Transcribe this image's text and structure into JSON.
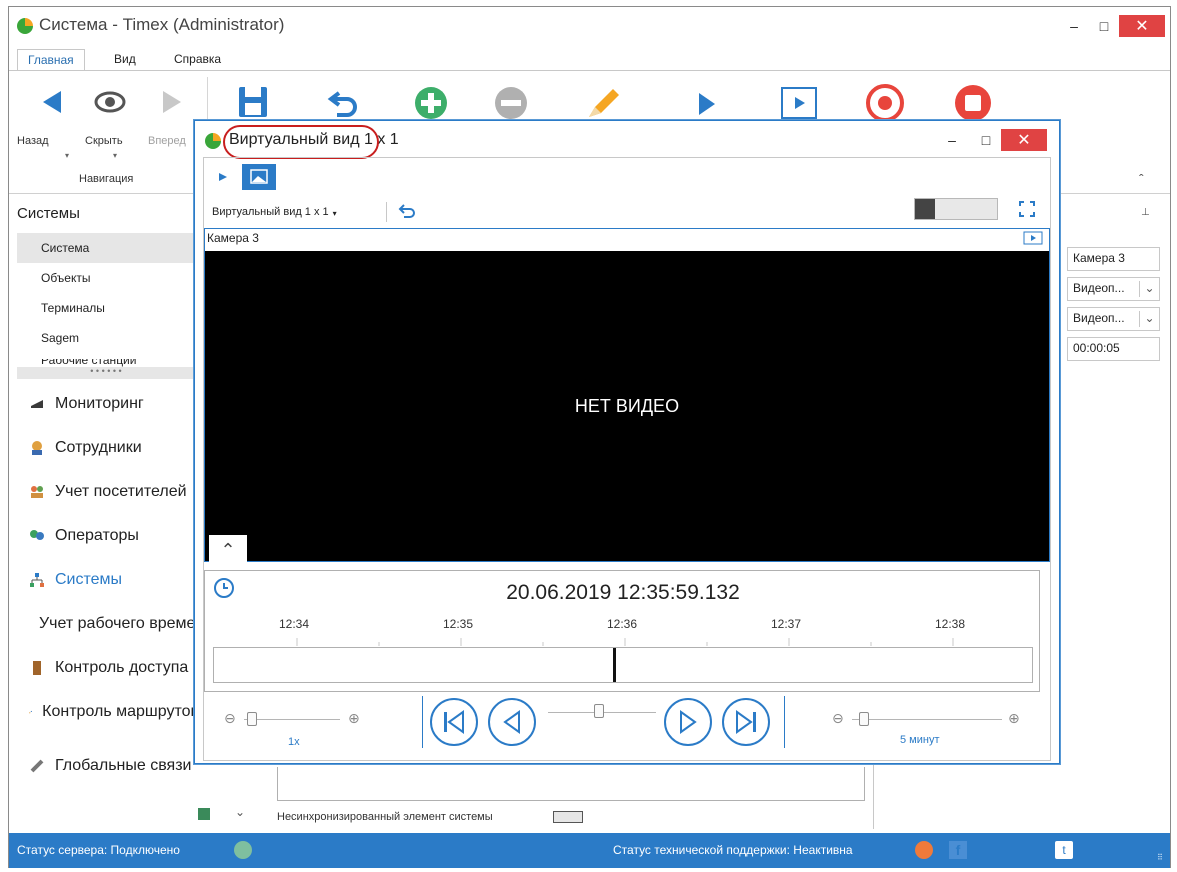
{
  "window": {
    "title": "Система - Timex (Administrator)",
    "minimize": "–",
    "maximize": "□",
    "close": "✕"
  },
  "menu": {
    "tabs": [
      "Главная",
      "Вид",
      "Справка"
    ]
  },
  "ribbon": {
    "nav_buttons": [
      "Назад",
      "Скрыть",
      "Вперед"
    ],
    "group_label": "Навигация"
  },
  "sidebar": {
    "section_title": "Системы",
    "tree_items": [
      "Система",
      "Объекты",
      "Терминалы",
      "Sagem",
      "Рабочие станции"
    ],
    "nav_items": [
      {
        "label": "Мониторинг",
        "icon": "monitor-icon"
      },
      {
        "label": "Сотрудники",
        "icon": "employees-icon"
      },
      {
        "label": "Учет посетителей",
        "icon": "visitors-icon"
      },
      {
        "label": "Операторы",
        "icon": "operators-icon"
      },
      {
        "label": "Системы",
        "icon": "systems-icon"
      },
      {
        "label": "Учет рабочего времени",
        "icon": "clock-icon"
      },
      {
        "label": "Контроль доступа",
        "icon": "door-icon"
      },
      {
        "label": "Контроль маршрутов",
        "icon": "route-icon"
      },
      {
        "label": "Глобальные связи",
        "icon": "link-icon"
      }
    ]
  },
  "right_panel": {
    "camera": "Камера 3",
    "select1": "Видеоп...",
    "select2": "Видеоп...",
    "time": "00:00:05"
  },
  "legend": {
    "unsync_label": "Несинхронизированный элемент системы"
  },
  "status": {
    "server": "Статус сервера: Подключено",
    "support": "Статус технической поддержки: Неактивна",
    "server_color": "#7fbf9f",
    "support_color": "#f07a3a"
  },
  "vwin": {
    "title": "Виртуальный вид 1 x 1",
    "view_dropdown": "Виртуальный вид 1 x 1",
    "camera_label": "Камера 3",
    "no_video": "НЕТ ВИДЕО",
    "timestamp": "20.06.2019 12:35:59.132",
    "ticks": [
      "12:34",
      "12:35",
      "12:36",
      "12:37",
      "12:38"
    ],
    "speed_label": "1x",
    "range_label": "5 минут",
    "cursor_fraction": 0.49,
    "speed_fraction": 0.08,
    "range_fraction": 0.08
  },
  "colors": {
    "accent": "#2b7bc7",
    "close": "#e04343",
    "record": "#e8453c",
    "add": "#3dae6a"
  }
}
